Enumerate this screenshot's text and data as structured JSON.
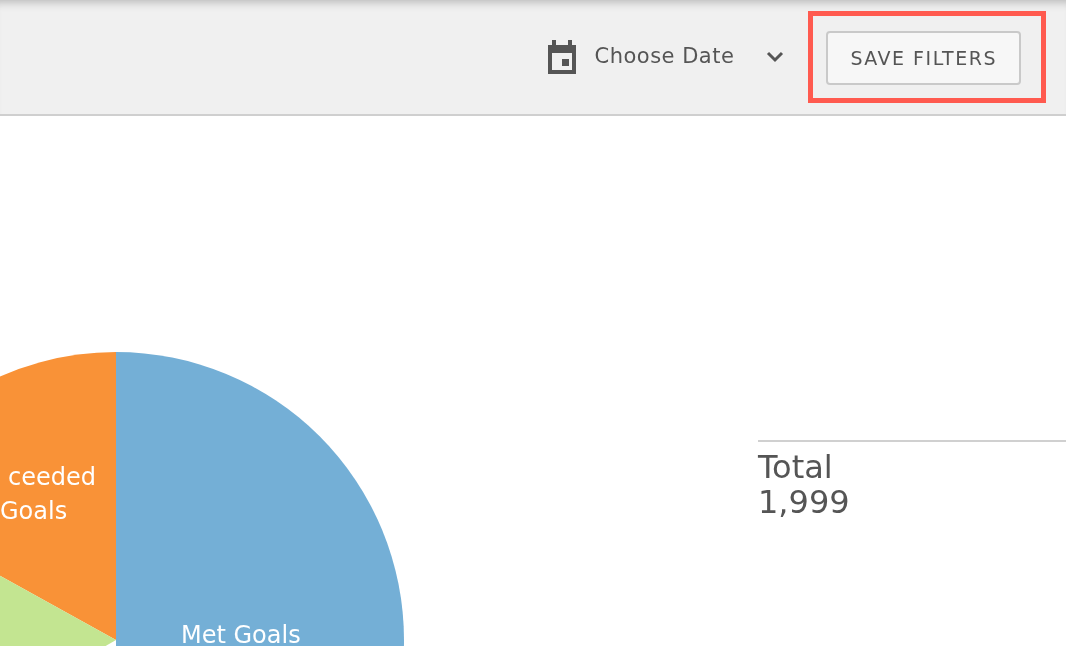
{
  "toolbar": {
    "date_picker": {
      "label": "Choose Date"
    },
    "save_button": {
      "label": "SAVE FILTERS",
      "highlighted": true
    }
  },
  "pie": {
    "slices": [
      {
        "label_lines": [
          "ceeded",
          "Goals"
        ],
        "color": "#f99237"
      },
      {
        "label_lines": [
          "Met Goals"
        ],
        "color": "#74afd6"
      },
      {
        "color": "#c3e591"
      }
    ]
  },
  "total": {
    "label": "Total",
    "value": "1,999"
  }
}
